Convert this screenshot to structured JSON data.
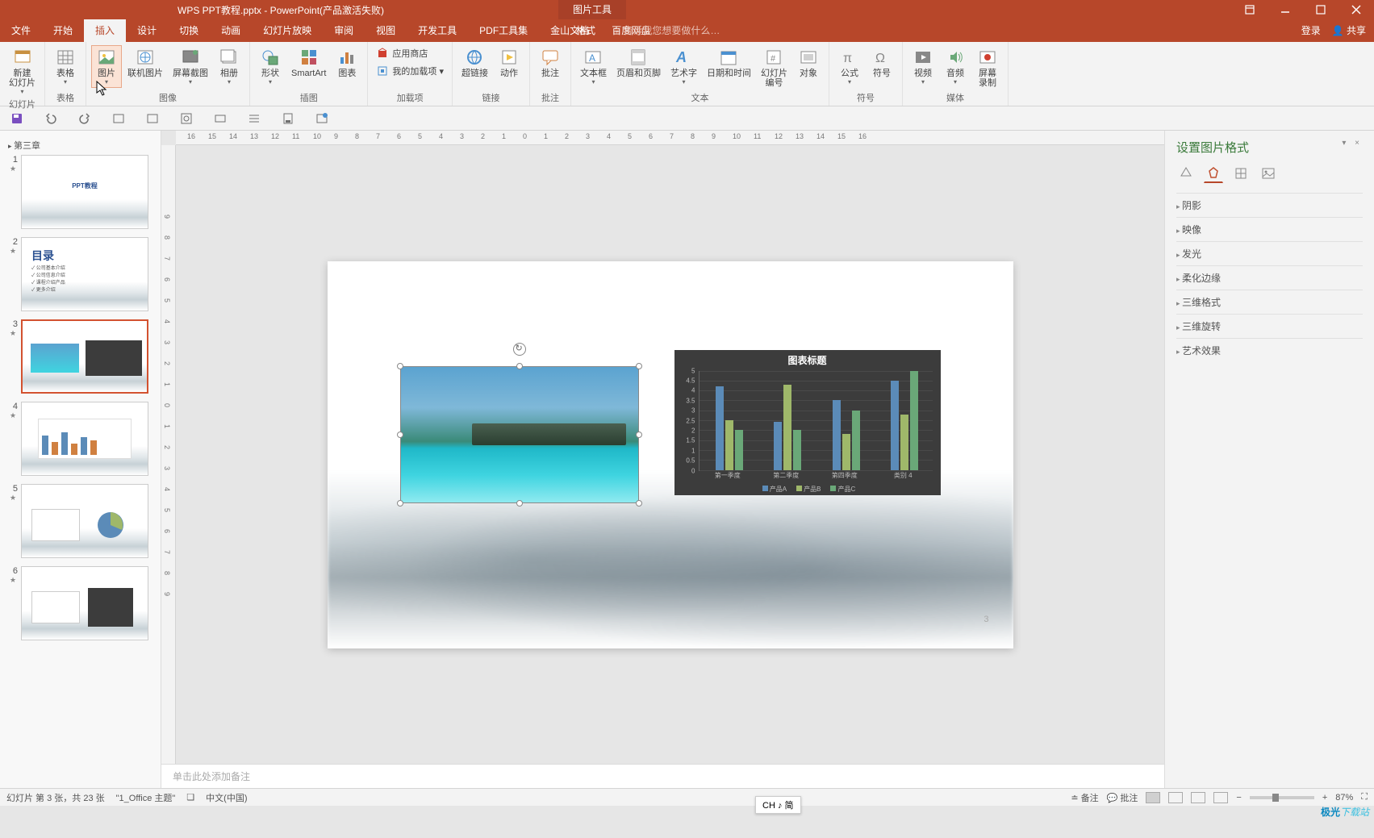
{
  "title": "WPS PPT教程.pptx - PowerPoint(产品激活失败)",
  "context_tab_group": "图片工具",
  "tabs": [
    "文件",
    "开始",
    "插入",
    "设计",
    "切换",
    "动画",
    "幻灯片放映",
    "审阅",
    "视图",
    "开发工具",
    "PDF工具集",
    "金山文档",
    "百度网盘"
  ],
  "context_tab": "格式",
  "tell_me": "♀ 告诉我您想要做什么…",
  "login": "登录",
  "share": "共享",
  "ribbon": {
    "groups": [
      {
        "label": "幻灯片",
        "buttons": [
          {
            "name": "new-slide",
            "label": "新建\n幻灯片",
            "icon": "new-slide-icon",
            "drop": true
          }
        ]
      },
      {
        "label": "表格",
        "buttons": [
          {
            "name": "table",
            "label": "表格",
            "icon": "table-icon",
            "drop": true
          }
        ]
      },
      {
        "label": "图像",
        "buttons": [
          {
            "name": "picture",
            "label": "图片",
            "icon": "picture-icon",
            "drop": true,
            "selected": true
          },
          {
            "name": "online-picture",
            "label": "联机图片",
            "icon": "online-picture-icon"
          },
          {
            "name": "screenshot",
            "label": "屏幕截图",
            "icon": "screenshot-icon",
            "drop": true
          },
          {
            "name": "album",
            "label": "相册",
            "icon": "album-icon",
            "drop": true
          }
        ]
      },
      {
        "label": "插图",
        "buttons": [
          {
            "name": "shapes",
            "label": "形状",
            "icon": "shapes-icon",
            "drop": true
          },
          {
            "name": "smartart",
            "label": "SmartArt",
            "icon": "smartart-icon"
          },
          {
            "name": "chart",
            "label": "图表",
            "icon": "chart-icon"
          }
        ]
      },
      {
        "label": "加载项",
        "mini": [
          {
            "name": "app-store",
            "label": "应用商店",
            "icon": "store-icon"
          },
          {
            "name": "my-addins",
            "label": "我的加载项 ▾",
            "icon": "addin-icon"
          }
        ]
      },
      {
        "label": "链接",
        "buttons": [
          {
            "name": "hyperlink",
            "label": "超链接",
            "icon": "link-icon"
          },
          {
            "name": "action",
            "label": "动作",
            "icon": "action-icon"
          }
        ]
      },
      {
        "label": "批注",
        "buttons": [
          {
            "name": "comment",
            "label": "批注",
            "icon": "comment-icon"
          }
        ]
      },
      {
        "label": "文本",
        "buttons": [
          {
            "name": "textbox",
            "label": "文本框",
            "icon": "textbox-icon",
            "drop": true
          },
          {
            "name": "header-footer",
            "label": "页眉和页脚",
            "icon": "header-icon"
          },
          {
            "name": "wordart",
            "label": "艺术字",
            "icon": "wordart-icon",
            "drop": true
          },
          {
            "name": "date-time",
            "label": "日期和时间",
            "icon": "date-icon"
          },
          {
            "name": "slide-number",
            "label": "幻灯片\n编号",
            "icon": "number-icon"
          },
          {
            "name": "object",
            "label": "对象",
            "icon": "object-icon"
          }
        ]
      },
      {
        "label": "符号",
        "buttons": [
          {
            "name": "equation",
            "label": "公式",
            "icon": "equation-icon",
            "drop": true
          },
          {
            "name": "symbol",
            "label": "符号",
            "icon": "symbol-icon"
          }
        ]
      },
      {
        "label": "媒体",
        "buttons": [
          {
            "name": "video",
            "label": "视频",
            "icon": "video-icon",
            "drop": true
          },
          {
            "name": "audio",
            "label": "音频",
            "icon": "audio-icon",
            "drop": true
          },
          {
            "name": "screen-record",
            "label": "屏幕\n录制",
            "icon": "record-icon"
          }
        ]
      }
    ]
  },
  "section_name": "第三章",
  "format_panel": {
    "title": "设置图片格式",
    "sections": [
      "阴影",
      "映像",
      "发光",
      "柔化边缘",
      "三维格式",
      "三维旋转",
      "艺术效果"
    ]
  },
  "notes_placeholder": "单击此处添加备注",
  "status": {
    "slide_info": "幻灯片 第 3 张，共 23 张",
    "theme": "\"1_Office 主题\"",
    "lang": "中文(中国)",
    "notes_btn": "备注",
    "comments_btn": "批注",
    "zoom": "87%"
  },
  "ime": "CH ♪ 简",
  "chart_data": {
    "type": "bar",
    "title": "图表标题",
    "categories": [
      "第一季度",
      "第二季度",
      "第四季度",
      "类别 4"
    ],
    "series": [
      {
        "name": "产品A",
        "color": "#5b8bb8",
        "values": [
          4.2,
          2.4,
          3.5,
          4.5
        ]
      },
      {
        "name": "产品B",
        "color": "#9fb86a",
        "values": [
          2.5,
          4.3,
          1.8,
          2.8
        ]
      },
      {
        "name": "产品C",
        "color": "#6aa878",
        "values": [
          2.0,
          2.0,
          3.0,
          5.0
        ]
      }
    ],
    "ylim": [
      0,
      5
    ],
    "yticks": [
      0,
      0.5,
      1,
      1.5,
      2,
      2.5,
      3,
      3.5,
      4,
      4.5,
      5
    ]
  },
  "thumbs": {
    "2": {
      "title": "目录",
      "items": [
        "公司基本介绍",
        "公司信息介绍",
        "课程介绍产品",
        "更多介绍"
      ]
    }
  },
  "slide_page_num": "3",
  "watermark": {
    "a": "极光",
    "b": "下载站"
  }
}
